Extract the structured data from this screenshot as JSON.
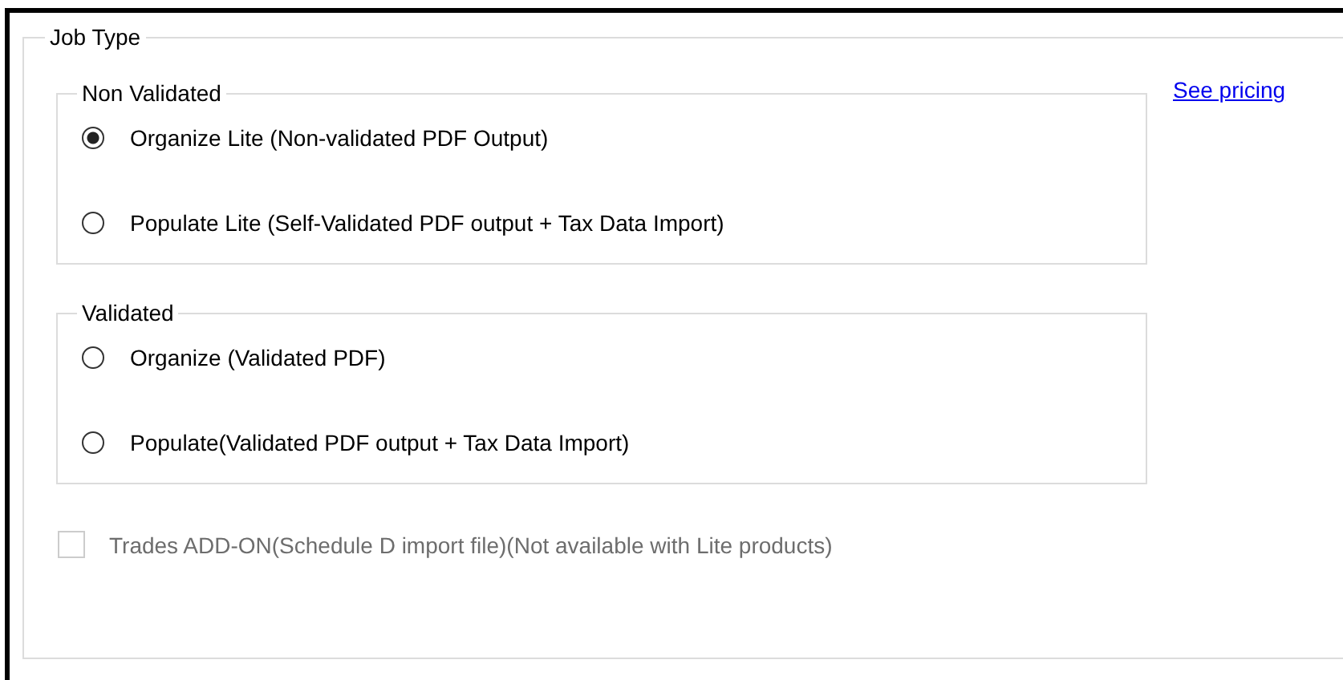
{
  "group": {
    "title": "Job Type"
  },
  "sections": [
    {
      "title": "Non Validated",
      "options": [
        {
          "label": "Organize Lite (Non-validated PDF Output)",
          "selected": true
        },
        {
          "label": "Populate Lite (Self-Validated PDF output + Tax Data Import)",
          "selected": false
        }
      ]
    },
    {
      "title": "Validated",
      "options": [
        {
          "label": "Organize (Validated PDF)",
          "selected": false
        },
        {
          "label": "Populate(Validated PDF output + Tax Data Import)",
          "selected": false
        }
      ]
    }
  ],
  "link": "See pricing",
  "addon": {
    "label": "Trades ADD-ON(Schedule D import file)(Not available with Lite products)",
    "checked": false,
    "disabled": true
  }
}
